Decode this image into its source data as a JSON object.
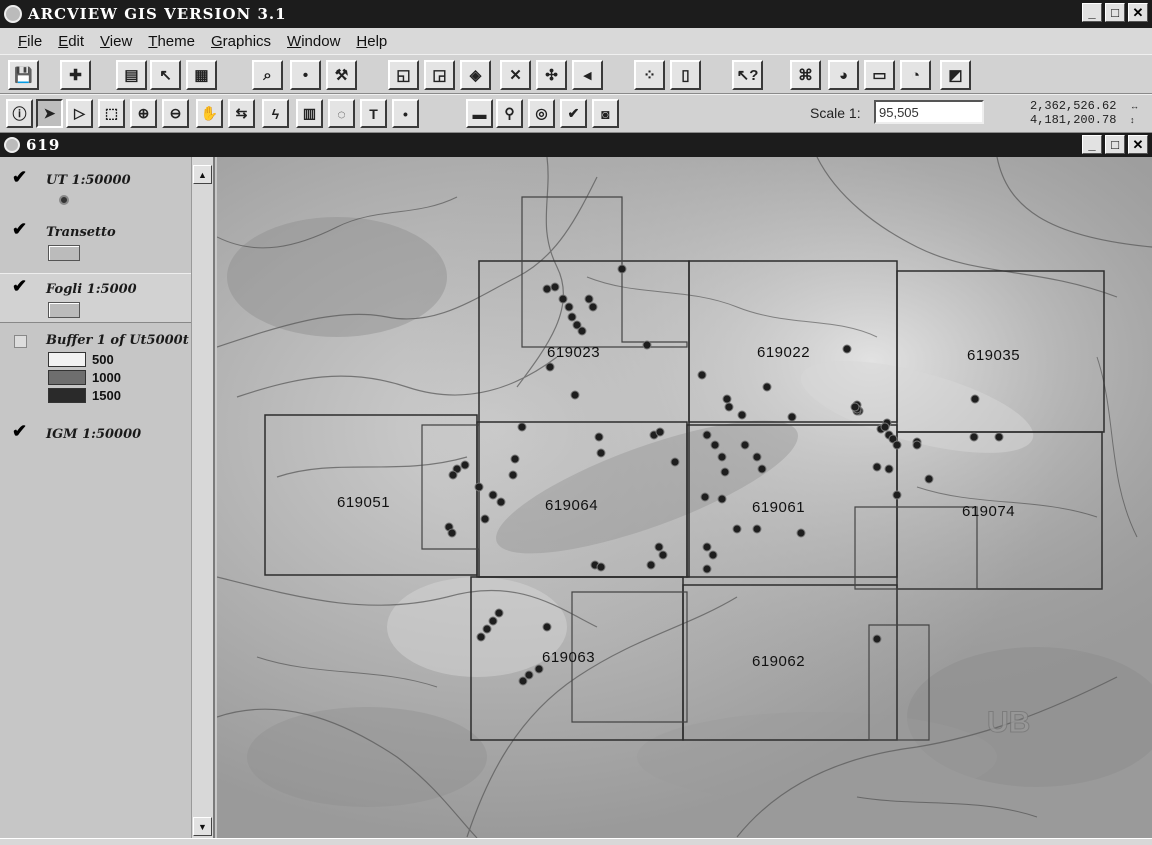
{
  "app": {
    "title": "ARCVIEW GIS VERSION 3.1"
  },
  "window_buttons": {
    "minimize": "_",
    "maximize": "□",
    "close": "✕"
  },
  "menu": [
    {
      "key": "F",
      "rest": "ile"
    },
    {
      "key": "E",
      "rest": "dit"
    },
    {
      "key": "V",
      "rest": "iew"
    },
    {
      "key": "T",
      "rest": "heme"
    },
    {
      "key": "G",
      "rest": "raphics"
    },
    {
      "key": "W",
      "rest": "indow"
    },
    {
      "key": "H",
      "rest": "elp"
    }
  ],
  "toolbar1": [
    {
      "name": "save-button",
      "glyph": "💾"
    },
    {
      "name": "add-theme-button",
      "glyph": "✚"
    },
    {
      "name": "theme-properties-button",
      "glyph": "▤"
    },
    {
      "name": "edit-legend-button",
      "glyph": "↖"
    },
    {
      "name": "open-table-button",
      "glyph": "▦"
    },
    {
      "name": "find-button",
      "glyph": "⌕"
    },
    {
      "name": "locate-address-button",
      "glyph": "•"
    },
    {
      "name": "query-builder-button",
      "glyph": "⚒"
    },
    {
      "name": "zoom-full-extent-button",
      "glyph": "◱"
    },
    {
      "name": "zoom-active-theme-button",
      "glyph": "◲"
    },
    {
      "name": "zoom-selected-button",
      "glyph": "◈"
    },
    {
      "name": "zoom-in-fixed-button",
      "glyph": "✕"
    },
    {
      "name": "zoom-out-fixed-button",
      "glyph": "✣"
    },
    {
      "name": "zoom-previous-button",
      "glyph": "◂"
    },
    {
      "name": "select-by-theme-button",
      "glyph": "⁘"
    },
    {
      "name": "clear-selection-button",
      "glyph": "▯"
    },
    {
      "name": "help-button",
      "glyph": "↖?"
    },
    {
      "name": "hotlink-button",
      "glyph": "⌘"
    },
    {
      "name": "layout-button",
      "glyph": "◕"
    },
    {
      "name": "print-button",
      "glyph": "▭"
    },
    {
      "name": "clock-button",
      "glyph": "◔"
    },
    {
      "name": "export-button",
      "glyph": "◩"
    }
  ],
  "toolbar2": [
    {
      "name": "identify-tool",
      "glyph": "ⓘ"
    },
    {
      "name": "pointer-tool",
      "glyph": "➤"
    },
    {
      "name": "vertex-edit-tool",
      "glyph": "▷"
    },
    {
      "name": "select-feature-tool",
      "glyph": "⬚"
    },
    {
      "name": "zoom-in-tool",
      "glyph": "⊕"
    },
    {
      "name": "zoom-out-tool",
      "glyph": "⊖"
    },
    {
      "name": "pan-tool",
      "glyph": "✋"
    },
    {
      "name": "measure-tool",
      "glyph": "⇆"
    },
    {
      "name": "hotlink-tool",
      "glyph": "ϟ"
    },
    {
      "name": "label-tool",
      "glyph": "▥"
    },
    {
      "name": "callout-tool",
      "glyph": "◌"
    },
    {
      "name": "text-tool",
      "glyph": "T"
    },
    {
      "name": "draw-point-tool",
      "glyph": "•"
    },
    {
      "name": "snap-tool",
      "glyph": "▬"
    },
    {
      "name": "pin-tool",
      "glyph": "⚲"
    },
    {
      "name": "circle-tool",
      "glyph": "◎"
    },
    {
      "name": "check-tool",
      "glyph": "✔"
    },
    {
      "name": "camera-tool",
      "glyph": "◙"
    }
  ],
  "scale": {
    "label": "Scale 1:",
    "value": "95,505"
  },
  "coordinates": {
    "x": "2,362,526.62",
    "y": "4,181,200.78",
    "arrows": "↔\n↕"
  },
  "view_window": {
    "title": "619"
  },
  "legend": {
    "layers": [
      {
        "name": "UT 1:50000",
        "checked": true,
        "symbol": "point"
      },
      {
        "name": "Transetto",
        "checked": true,
        "symbol": "rect"
      },
      {
        "name": "Fogli 1:5000",
        "checked": true,
        "symbol": "rect",
        "active": true
      },
      {
        "name": "Buffer 1 of Ut5000t",
        "checked": false,
        "symbol": "ramp",
        "classes": [
          {
            "label": "500",
            "color": "#f2f2f2"
          },
          {
            "label": "1000",
            "color": "#6e6e6e"
          },
          {
            "label": "1500",
            "color": "#2a2a2a"
          }
        ]
      },
      {
        "name": "IGM 1:50000",
        "checked": true,
        "symbol": "none"
      }
    ],
    "check_glyph": "✔"
  },
  "scrollbar": {
    "up": "▲",
    "down": "▼"
  },
  "map": {
    "sheet_labels": [
      "619023",
      "619022",
      "619035",
      "619051",
      "619064",
      "619061",
      "619074",
      "619063",
      "619062"
    ],
    "watermark_text": "UB"
  }
}
